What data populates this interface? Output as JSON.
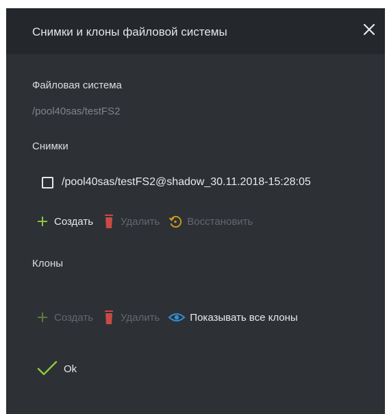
{
  "dialog": {
    "title": "Снимки и клоны файловой системы"
  },
  "filesystem": {
    "label": "Файловая система",
    "path": "/pool40sas/testFS2"
  },
  "snapshots": {
    "label": "Снимки",
    "items": [
      {
        "name": "/pool40sas/testFS2@shadow_30.11.2018-15:28:05",
        "checked": false
      }
    ],
    "toolbar": {
      "create_label": "Создать",
      "delete_label": "Удалить",
      "restore_label": "Восстановить"
    }
  },
  "clones": {
    "label": "Клоны",
    "toolbar": {
      "create_label": "Создать",
      "delete_label": "Удалить",
      "show_all_label": "Показывать все клоны"
    }
  },
  "footer": {
    "ok_label": "Ok"
  },
  "colors": {
    "background": "#2d3035",
    "header": "#24272b",
    "plus_green": "#8cc63f",
    "delete_red": "#c74b45",
    "restore_amber": "#c99a1c",
    "eye_blue": "#2f8fd8",
    "check_green": "#8cc63f"
  },
  "icons": {
    "close": "close-icon",
    "plus": "plus-icon",
    "trash": "trash-icon",
    "restore": "restore-icon",
    "eye": "eye-icon",
    "check": "check-icon"
  }
}
